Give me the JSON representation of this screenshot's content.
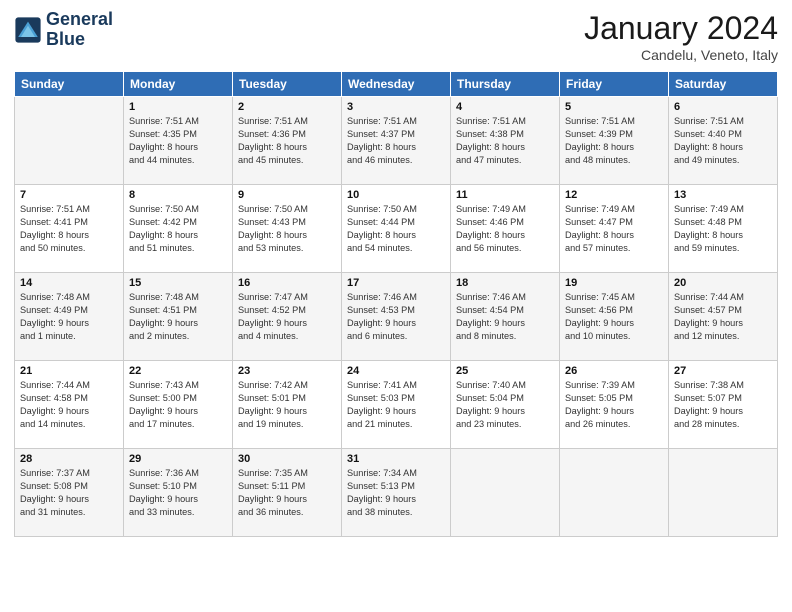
{
  "header": {
    "logo_line1": "General",
    "logo_line2": "Blue",
    "month": "January 2024",
    "location": "Candelu, Veneto, Italy"
  },
  "weekdays": [
    "Sunday",
    "Monday",
    "Tuesday",
    "Wednesday",
    "Thursday",
    "Friday",
    "Saturday"
  ],
  "weeks": [
    [
      {
        "day": "",
        "lines": []
      },
      {
        "day": "1",
        "lines": [
          "Sunrise: 7:51 AM",
          "Sunset: 4:35 PM",
          "Daylight: 8 hours",
          "and 44 minutes."
        ]
      },
      {
        "day": "2",
        "lines": [
          "Sunrise: 7:51 AM",
          "Sunset: 4:36 PM",
          "Daylight: 8 hours",
          "and 45 minutes."
        ]
      },
      {
        "day": "3",
        "lines": [
          "Sunrise: 7:51 AM",
          "Sunset: 4:37 PM",
          "Daylight: 8 hours",
          "and 46 minutes."
        ]
      },
      {
        "day": "4",
        "lines": [
          "Sunrise: 7:51 AM",
          "Sunset: 4:38 PM",
          "Daylight: 8 hours",
          "and 47 minutes."
        ]
      },
      {
        "day": "5",
        "lines": [
          "Sunrise: 7:51 AM",
          "Sunset: 4:39 PM",
          "Daylight: 8 hours",
          "and 48 minutes."
        ]
      },
      {
        "day": "6",
        "lines": [
          "Sunrise: 7:51 AM",
          "Sunset: 4:40 PM",
          "Daylight: 8 hours",
          "and 49 minutes."
        ]
      }
    ],
    [
      {
        "day": "7",
        "lines": [
          "Sunrise: 7:51 AM",
          "Sunset: 4:41 PM",
          "Daylight: 8 hours",
          "and 50 minutes."
        ]
      },
      {
        "day": "8",
        "lines": [
          "Sunrise: 7:50 AM",
          "Sunset: 4:42 PM",
          "Daylight: 8 hours",
          "and 51 minutes."
        ]
      },
      {
        "day": "9",
        "lines": [
          "Sunrise: 7:50 AM",
          "Sunset: 4:43 PM",
          "Daylight: 8 hours",
          "and 53 minutes."
        ]
      },
      {
        "day": "10",
        "lines": [
          "Sunrise: 7:50 AM",
          "Sunset: 4:44 PM",
          "Daylight: 8 hours",
          "and 54 minutes."
        ]
      },
      {
        "day": "11",
        "lines": [
          "Sunrise: 7:49 AM",
          "Sunset: 4:46 PM",
          "Daylight: 8 hours",
          "and 56 minutes."
        ]
      },
      {
        "day": "12",
        "lines": [
          "Sunrise: 7:49 AM",
          "Sunset: 4:47 PM",
          "Daylight: 8 hours",
          "and 57 minutes."
        ]
      },
      {
        "day": "13",
        "lines": [
          "Sunrise: 7:49 AM",
          "Sunset: 4:48 PM",
          "Daylight: 8 hours",
          "and 59 minutes."
        ]
      }
    ],
    [
      {
        "day": "14",
        "lines": [
          "Sunrise: 7:48 AM",
          "Sunset: 4:49 PM",
          "Daylight: 9 hours",
          "and 1 minute."
        ]
      },
      {
        "day": "15",
        "lines": [
          "Sunrise: 7:48 AM",
          "Sunset: 4:51 PM",
          "Daylight: 9 hours",
          "and 2 minutes."
        ]
      },
      {
        "day": "16",
        "lines": [
          "Sunrise: 7:47 AM",
          "Sunset: 4:52 PM",
          "Daylight: 9 hours",
          "and 4 minutes."
        ]
      },
      {
        "day": "17",
        "lines": [
          "Sunrise: 7:46 AM",
          "Sunset: 4:53 PM",
          "Daylight: 9 hours",
          "and 6 minutes."
        ]
      },
      {
        "day": "18",
        "lines": [
          "Sunrise: 7:46 AM",
          "Sunset: 4:54 PM",
          "Daylight: 9 hours",
          "and 8 minutes."
        ]
      },
      {
        "day": "19",
        "lines": [
          "Sunrise: 7:45 AM",
          "Sunset: 4:56 PM",
          "Daylight: 9 hours",
          "and 10 minutes."
        ]
      },
      {
        "day": "20",
        "lines": [
          "Sunrise: 7:44 AM",
          "Sunset: 4:57 PM",
          "Daylight: 9 hours",
          "and 12 minutes."
        ]
      }
    ],
    [
      {
        "day": "21",
        "lines": [
          "Sunrise: 7:44 AM",
          "Sunset: 4:58 PM",
          "Daylight: 9 hours",
          "and 14 minutes."
        ]
      },
      {
        "day": "22",
        "lines": [
          "Sunrise: 7:43 AM",
          "Sunset: 5:00 PM",
          "Daylight: 9 hours",
          "and 17 minutes."
        ]
      },
      {
        "day": "23",
        "lines": [
          "Sunrise: 7:42 AM",
          "Sunset: 5:01 PM",
          "Daylight: 9 hours",
          "and 19 minutes."
        ]
      },
      {
        "day": "24",
        "lines": [
          "Sunrise: 7:41 AM",
          "Sunset: 5:03 PM",
          "Daylight: 9 hours",
          "and 21 minutes."
        ]
      },
      {
        "day": "25",
        "lines": [
          "Sunrise: 7:40 AM",
          "Sunset: 5:04 PM",
          "Daylight: 9 hours",
          "and 23 minutes."
        ]
      },
      {
        "day": "26",
        "lines": [
          "Sunrise: 7:39 AM",
          "Sunset: 5:05 PM",
          "Daylight: 9 hours",
          "and 26 minutes."
        ]
      },
      {
        "day": "27",
        "lines": [
          "Sunrise: 7:38 AM",
          "Sunset: 5:07 PM",
          "Daylight: 9 hours",
          "and 28 minutes."
        ]
      }
    ],
    [
      {
        "day": "28",
        "lines": [
          "Sunrise: 7:37 AM",
          "Sunset: 5:08 PM",
          "Daylight: 9 hours",
          "and 31 minutes."
        ]
      },
      {
        "day": "29",
        "lines": [
          "Sunrise: 7:36 AM",
          "Sunset: 5:10 PM",
          "Daylight: 9 hours",
          "and 33 minutes."
        ]
      },
      {
        "day": "30",
        "lines": [
          "Sunrise: 7:35 AM",
          "Sunset: 5:11 PM",
          "Daylight: 9 hours",
          "and 36 minutes."
        ]
      },
      {
        "day": "31",
        "lines": [
          "Sunrise: 7:34 AM",
          "Sunset: 5:13 PM",
          "Daylight: 9 hours",
          "and 38 minutes."
        ]
      },
      {
        "day": "",
        "lines": []
      },
      {
        "day": "",
        "lines": []
      },
      {
        "day": "",
        "lines": []
      }
    ]
  ]
}
